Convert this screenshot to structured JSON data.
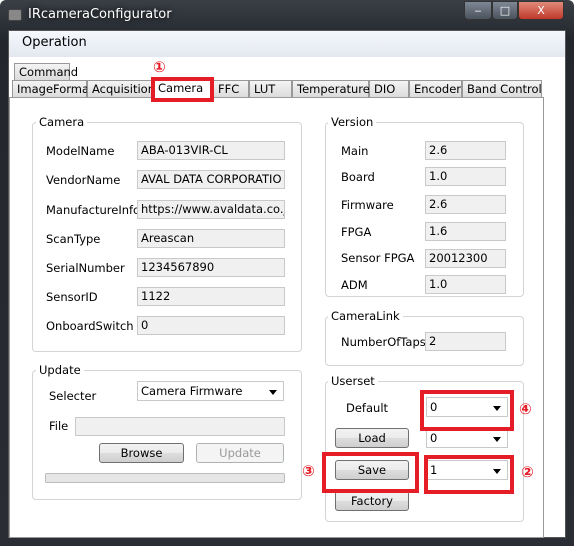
{
  "window": {
    "title": "IRcameraConfigurator",
    "minimize": "‒",
    "maximize": "□",
    "close": "X"
  },
  "menu": {
    "operation": "Operation"
  },
  "tabs": {
    "command": "Command",
    "row": [
      "ImageFormat",
      "Acquisition",
      "Camera",
      "FFC",
      "LUT",
      "Temperature",
      "DIO",
      "Encoder",
      "Band Control"
    ],
    "selected": "Camera"
  },
  "camera": {
    "title": "Camera",
    "fields": [
      {
        "label": "ModelName",
        "value": "ABA-013VIR-CL"
      },
      {
        "label": "VendorName",
        "value": "AVAL DATA CORPORATIO"
      },
      {
        "label": "ManufactureInfo",
        "value": "https://www.avaldata.co.jp"
      },
      {
        "label": "ScanType",
        "value": "Areascan"
      },
      {
        "label": "SerialNumber",
        "value": "1234567890"
      },
      {
        "label": "SensorID",
        "value": "1122"
      },
      {
        "label": "OnboardSwitch",
        "value": "0"
      }
    ]
  },
  "update": {
    "title": "Update",
    "selecter_label": "Selecter",
    "selecter_value": "Camera Firmware",
    "file_label": "File",
    "file_value": "",
    "browse": "Browse",
    "update": "Update",
    "progress": 0
  },
  "version": {
    "title": "Version",
    "fields": [
      {
        "label": "Main",
        "value": "2.6"
      },
      {
        "label": "Board",
        "value": "1.0"
      },
      {
        "label": "Firmware",
        "value": "2.6"
      },
      {
        "label": "FPGA",
        "value": "1.6"
      },
      {
        "label": "Sensor FPGA",
        "value": "20012300"
      },
      {
        "label": "ADM",
        "value": "1.0"
      }
    ]
  },
  "cameralink": {
    "title": "CameraLink",
    "taps_label": "NumberOfTaps",
    "taps_value": "2"
  },
  "userset": {
    "title": "Userset",
    "default_label": "Default",
    "default_value": "0",
    "load": "Load",
    "load_value": "0",
    "save": "Save",
    "save_value": "1",
    "factory": "Factory"
  },
  "annotations": {
    "n1": "①",
    "n2": "②",
    "n3": "③",
    "n4": "④",
    "color": "#e51d26"
  }
}
